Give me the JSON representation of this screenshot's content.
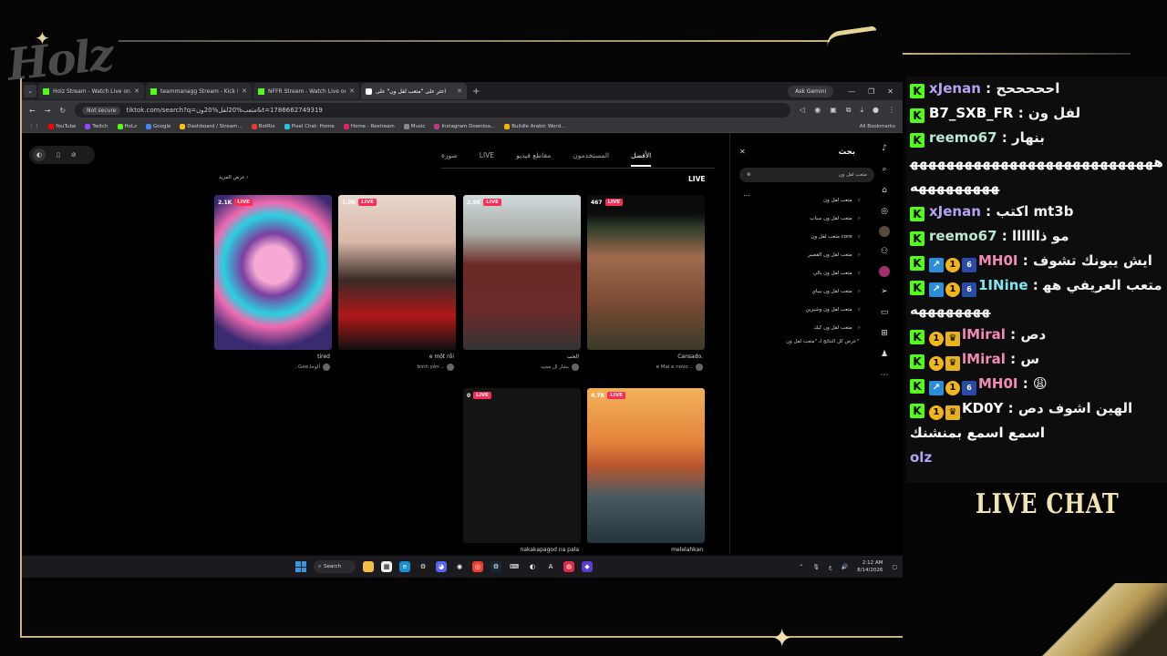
{
  "overlay": {
    "logo": "Holz",
    "live_chat_label": "LIVE CHAT"
  },
  "browser": {
    "tabs": [
      {
        "label": "Holz Stream - Watch Live on Ki",
        "icon": "kick-icon"
      },
      {
        "label": "teammanagg Stream - Kick Da",
        "icon": "kick-icon"
      },
      {
        "label": "NFFR Stream - Watch Live on K",
        "icon": "kick-icon"
      },
      {
        "label": "اعثر على \"متعب لفل ون\" على",
        "icon": "tiktok-icon",
        "active": true
      }
    ],
    "ask_gemini": "Ask Gemini",
    "not_secure": "Not secure",
    "url": "tiktok.com/search?q=متعب%20لفل%20ون&t=1786662749319",
    "bookmarks": [
      "YouTube",
      "Twitch",
      "HoLz",
      "Google",
      "Dashboard / Stream...",
      "BotRix",
      "Pixel Chat: Home",
      "Home - Restream",
      "Music",
      "Instagram Downloa...",
      "Buildle Arabic Word..."
    ],
    "all_bookmarks": "All Bookmarks"
  },
  "tiktok": {
    "result_tabs": [
      "الأفضل",
      "المستخدمون",
      "مقاطع فيديو",
      "LIVE",
      "صورة"
    ],
    "section_title": "LIVE",
    "see_more": "عرض المزيد",
    "live_label": "LIVE",
    "cards": [
      {
        "viewers": "2.1K",
        "caption": "tired",
        "author": "..Gee،ألوجا"
      },
      {
        "viewers": "1.0K",
        "caption": "e một rồi",
        "author": "bình yên .."
      },
      {
        "viewers": "2.9K",
        "caption": "الحب",
        "author": "بشار ال مجيد"
      },
      {
        "viewers": "467",
        "caption": "Cansado.",
        "author": "é Mai e novo .."
      },
      {
        "viewers": "0",
        "caption": "nakakapagod na pala",
        "author": ""
      },
      {
        "viewers": "4.7K",
        "caption": "melelahkan",
        "author": ""
      }
    ],
    "search": {
      "title": "بحث",
      "query": "متعب لفل ون",
      "suggestions": [
        "متعب لفل ون",
        "متعب لفل ون سناب",
        "متعب لفل ون core",
        "متعب لفل ون القصير",
        "متعب لفل ون يالي",
        "متعب لفل ون بيباي",
        "متعب لفل ون وشيرين",
        "متعب لفل ون كيك"
      ],
      "see_all": "عرض كل النتائج لـ \"متعب لفل ون\""
    }
  },
  "taskbar": {
    "search": "Search",
    "lang": "ع",
    "time": "2:12 AM",
    "date": "8/14/2026"
  },
  "chat": [
    {
      "badges": [
        "kick"
      ],
      "user": "xJenan",
      "color": "purple",
      "text": "احححححح"
    },
    {
      "badges": [
        "kick"
      ],
      "user": "B7_SXB_FR",
      "color": "white",
      "text": "لفل ون"
    },
    {
      "badges": [
        "kick"
      ],
      "user": "reemo67",
      "color": "green",
      "text": "بنهار"
    },
    {
      "badges": [],
      "user": "",
      "color": "white",
      "text": "هههههههههههههههههههههههههههههههههههههه"
    },
    {
      "badges": [
        "kick"
      ],
      "user": "xJenan",
      "color": "purple",
      "text": "اكتب mt3b"
    },
    {
      "badges": [
        "kick"
      ],
      "user": "reemo67",
      "color": "green",
      "text": "مو ذاااااا"
    },
    {
      "badges": [
        "kick",
        "s1",
        "s2",
        "s4"
      ],
      "user": "MH0I",
      "color": "pink",
      "text": "ايش يبونك تشوف"
    },
    {
      "badges": [
        "kick",
        "s1",
        "s2",
        "s4"
      ],
      "user": "1INine",
      "color": "cyan",
      "text": "متعب العريفي ههههههههههه"
    },
    {
      "badges": [
        "kick",
        "s2",
        "s3"
      ],
      "user": "lMiral",
      "color": "pink",
      "text": "دص"
    },
    {
      "badges": [
        "kick",
        "s2",
        "s3"
      ],
      "user": "lMiral",
      "color": "pink",
      "text": "س"
    },
    {
      "badges": [
        "kick",
        "s1",
        "s2",
        "s4"
      ],
      "user": "MH0I",
      "color": "pink",
      "text": "😩"
    },
    {
      "badges": [
        "kick",
        "s2",
        "s3"
      ],
      "user": "KD0Y",
      "color": "white",
      "text": "الهين اشوف دص"
    },
    {
      "badges": [],
      "user": "",
      "color": "white",
      "text": "اسمع اسمع بمنشنك"
    },
    {
      "badges": [],
      "user": "",
      "color": "purple",
      "text": "olz"
    }
  ]
}
